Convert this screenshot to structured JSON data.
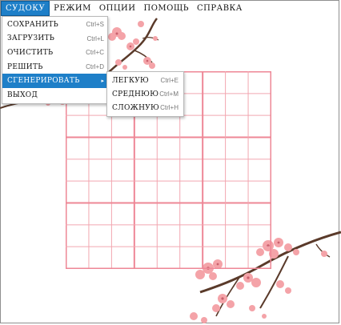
{
  "menubar": {
    "items": [
      {
        "label": "СУДОКУ",
        "active": true
      },
      {
        "label": "РЕЖИМ",
        "active": false
      },
      {
        "label": "ОПЦИИ",
        "active": false
      },
      {
        "label": "ПОМОЩЬ",
        "active": false
      },
      {
        "label": "СПРАВКА",
        "active": false
      }
    ]
  },
  "dropdown": {
    "items": [
      {
        "label": "СОХРАНИТЬ",
        "shortcut": "Ctrl+S"
      },
      {
        "label": "ЗАГРУЗИТЬ",
        "shortcut": "Ctrl+L"
      },
      {
        "label": "ОЧИСТИТЬ",
        "shortcut": "Ctrl+C"
      },
      {
        "label": "РЕШИТЬ",
        "shortcut": "Ctrl+D"
      },
      {
        "label": "СГЕНЕРИРОВАТЬ",
        "arrow": "▸",
        "highlighted": true
      },
      {
        "label": "ВЫХОД"
      }
    ]
  },
  "submenu": {
    "items": [
      {
        "label": "ЛЕГКУЮ",
        "shortcut": "Ctrl+E"
      },
      {
        "label": "СРЕДНЮЮ",
        "shortcut": "Ctrl+M"
      },
      {
        "label": "СЛОЖНУЮ",
        "shortcut": "Ctrl+H"
      }
    ]
  },
  "colors": {
    "accent": "#1e7fc8",
    "grid_line": "#f2a6b0",
    "grid_bold": "#ee8796",
    "blossom": "#f4a3a8",
    "branch": "#5a3a2a"
  },
  "icons": {
    "submenu_arrow": "chevron-right-icon",
    "decoration": "cherry-blossom-branch"
  }
}
